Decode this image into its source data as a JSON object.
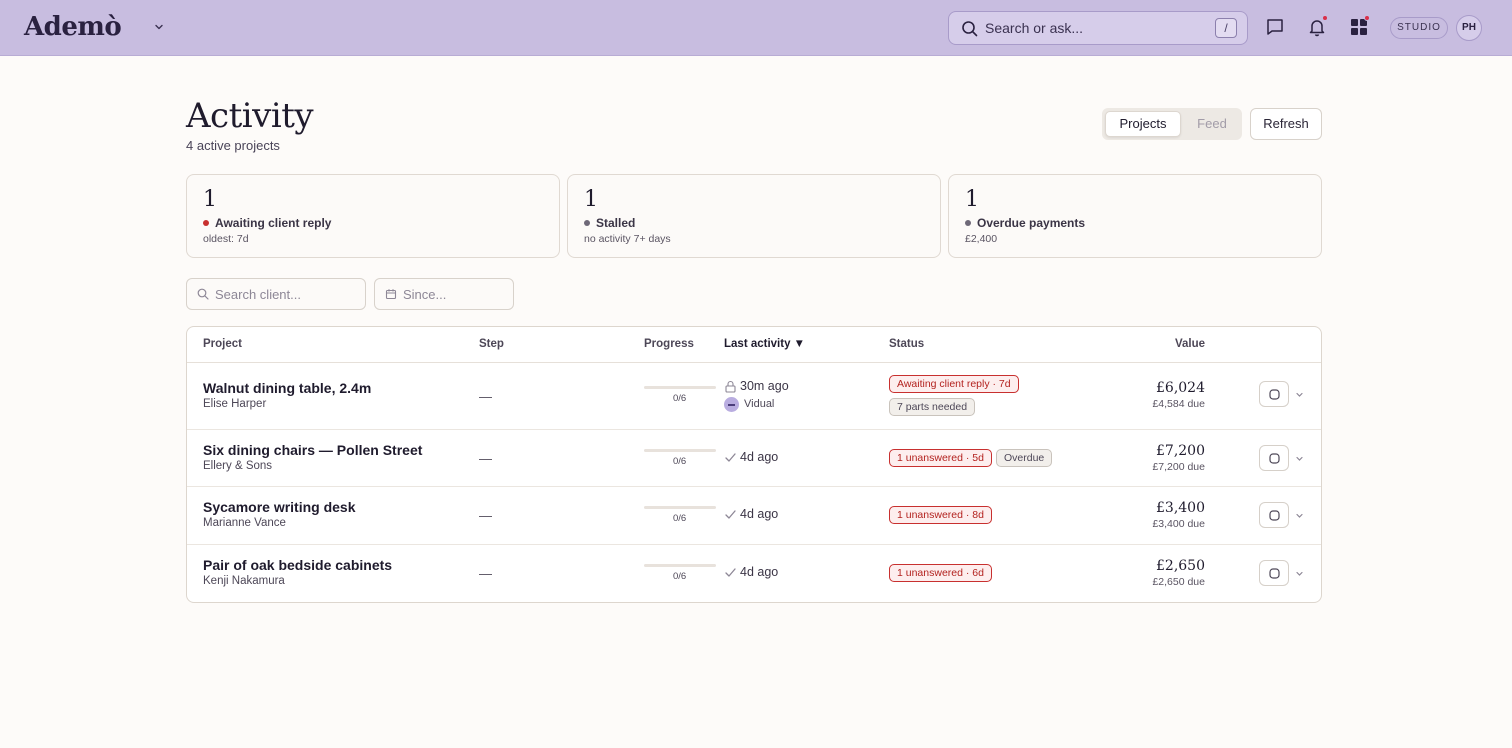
{
  "topbar": {
    "logo": "Ademò",
    "search_placeholder": "Search or ask...",
    "search_shortcut": "/",
    "studio_label": "STUDIO",
    "avatar_initials": "PH"
  },
  "header": {
    "title": "Activity",
    "subtitle": "4 active projects",
    "view_tabs": [
      "Projects",
      "Feed"
    ],
    "active_tab": "Projects",
    "refresh_label": "Refresh"
  },
  "stats": [
    {
      "count": "1",
      "label": "Awaiting client reply",
      "meta": "oldest: 7d",
      "dot_color": "#c8302f"
    },
    {
      "count": "1",
      "label": "Stalled",
      "meta": "no activity 7+ days",
      "dot_color": "#6e6878"
    },
    {
      "count": "1",
      "label": "Overdue payments",
      "meta": "£2,400",
      "dot_color": "#6e6878"
    }
  ],
  "filters": {
    "client_placeholder": "Search client...",
    "since_placeholder": "Since..."
  },
  "table": {
    "columns": {
      "project": "Project",
      "step": "Step",
      "progress": "Progress",
      "last_activity": "Last activity ▼",
      "status": "Status",
      "value": "Value"
    },
    "rows": [
      {
        "name": "Walnut dining table, 2.4m",
        "client": "Elise Harper",
        "step": "—",
        "progress_text": "0/6",
        "progress_fraction": 0,
        "activity_icon": "lock-icon",
        "activity": "30m ago",
        "activity_by": "Vidual",
        "badges": [
          {
            "text": "Awaiting client reply · 7d",
            "tone": "red"
          },
          {
            "text": "7 parts needed",
            "tone": "grey"
          }
        ],
        "value": "£6,024",
        "due": "£4,584 due"
      },
      {
        "name": "Six dining chairs — Pollen Street",
        "client": "Ellery & Sons",
        "step": "—",
        "progress_text": "0/6",
        "progress_fraction": 0,
        "activity_icon": "check-icon",
        "activity": "4d ago",
        "badges": [
          {
            "text": "1 unanswered · 5d",
            "tone": "red"
          },
          {
            "text": "Overdue",
            "tone": "grey"
          }
        ],
        "value": "£7,200",
        "due": "£7,200 due"
      },
      {
        "name": "Sycamore writing desk",
        "client": "Marianne Vance",
        "step": "—",
        "progress_text": "0/6",
        "progress_fraction": 0,
        "activity_icon": "check-icon",
        "activity": "4d ago",
        "badges": [
          {
            "text": "1 unanswered · 8d",
            "tone": "red"
          }
        ],
        "value": "£3,400",
        "due": "£3,400 due"
      },
      {
        "name": "Pair of oak bedside cabinets",
        "client": "Kenji Nakamura",
        "step": "—",
        "progress_text": "0/6",
        "progress_fraction": 0,
        "activity_icon": "check-icon",
        "activity": "4d ago",
        "badges": [
          {
            "text": "1 unanswered · 6d",
            "tone": "red"
          }
        ],
        "value": "£2,650",
        "due": "£2,650 due"
      }
    ]
  }
}
